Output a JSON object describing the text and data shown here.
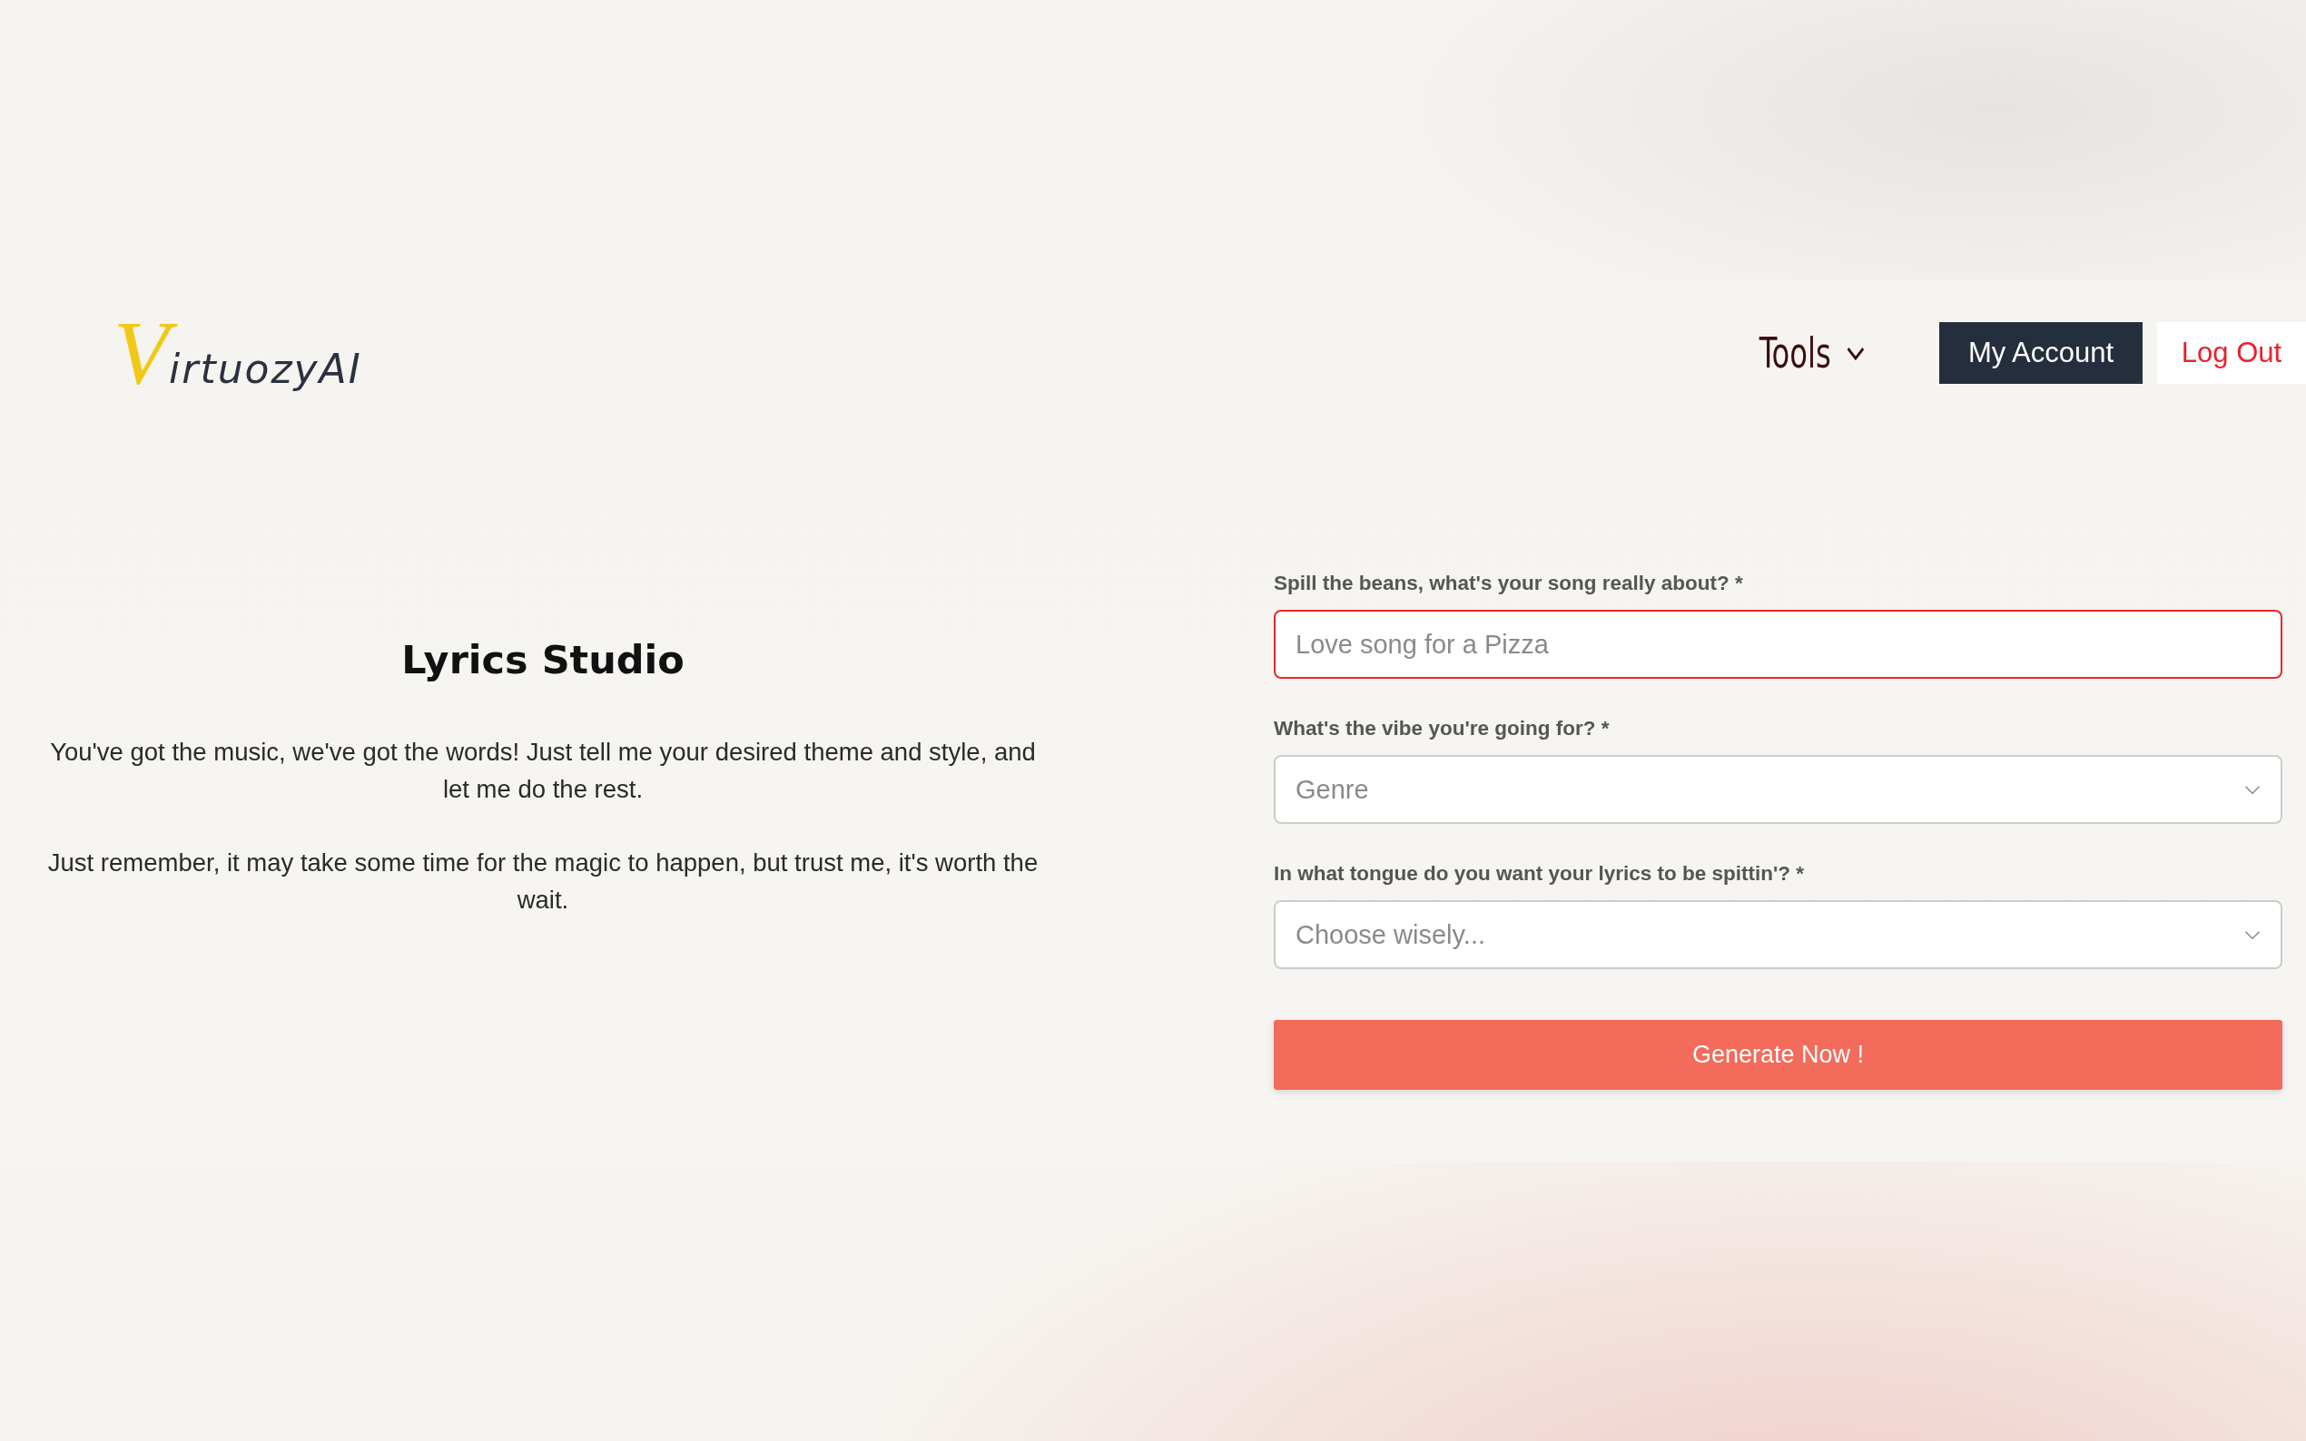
{
  "header": {
    "logo": {
      "initial": "V",
      "rest": "irtuozyAI"
    },
    "nav": {
      "label": "Tools",
      "expanded": false
    },
    "buttons": [
      {
        "kind": "primary",
        "label": "My Account"
      },
      {
        "kind": "link",
        "label": "Log Out"
      }
    ]
  },
  "intro": {
    "title": "Lyrics Studio",
    "paragraphs": [
      "You've got the music, we've got the words! Just tell me your desired theme and style, and let me do the rest.",
      "Just remember, it may take some time for the magic to happen, but trust me, it's worth the wait."
    ]
  },
  "form": {
    "fields": [
      {
        "kind": "text",
        "label": "Spill the beans, what's your song really about? *",
        "placeholder": "Love song for a Pizza",
        "focused": true
      },
      {
        "kind": "select",
        "label": "What's the vibe you're going for? *",
        "placeholder": "Genre",
        "focused": false
      },
      {
        "kind": "select",
        "label": "In what tongue do you want your lyrics to be spittin'? *",
        "placeholder": "Choose wisely...",
        "focused": false
      }
    ],
    "submit": "Generate Now !"
  }
}
